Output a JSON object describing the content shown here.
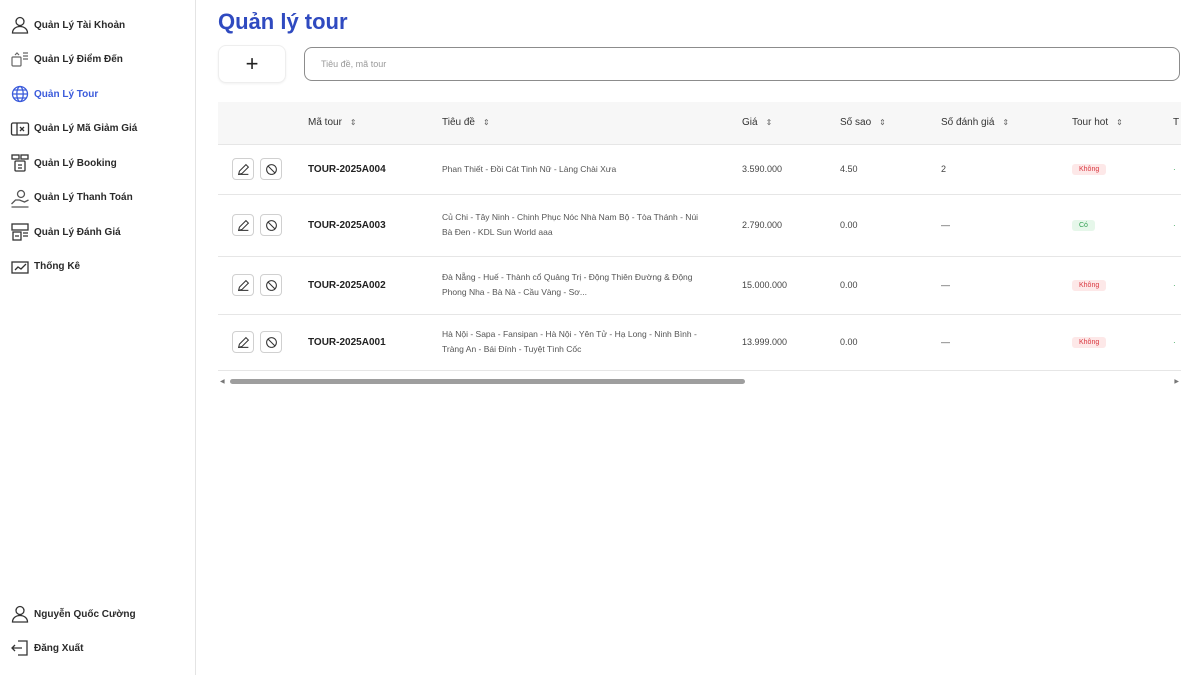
{
  "sidebar": {
    "items": [
      {
        "label": "Quản Lý Tài Khoản",
        "icon": "user-icon"
      },
      {
        "label": "Quản Lý Điểm Đến",
        "icon": "location-icon"
      },
      {
        "label": "Quản Lý Tour",
        "icon": "globe-icon",
        "active": true
      },
      {
        "label": "Quản Lý Mã Giảm Giá",
        "icon": "ticket-icon"
      },
      {
        "label": "Quản Lý Booking",
        "icon": "booking-icon"
      },
      {
        "label": "Quản Lý Thanh Toán",
        "icon": "payment-icon"
      },
      {
        "label": "Quản Lý Đánh Giá",
        "icon": "review-icon"
      },
      {
        "label": "Thống Kê",
        "icon": "chart-icon"
      }
    ],
    "user_name": "Nguyễn Quốc Cường",
    "logout_label": "Đăng Xuất"
  },
  "main": {
    "title": "Quản lý tour",
    "add_button": "+",
    "search_placeholder": "Tiêu đề, mã tour"
  },
  "table": {
    "headers": [
      "Mã tour",
      "Tiêu đề",
      "Giá",
      "Số sao",
      "Số đánh giá",
      "Tour hot",
      "T"
    ],
    "rows": [
      {
        "code": "TOUR-2025A004",
        "title": "Phan Thiết - Đồi Cát Tinh Nữ - Làng Chài Xưa",
        "price": "3.590.000",
        "stars": "4.50",
        "reviews": "2",
        "hot": "Không",
        "hot_type": "no"
      },
      {
        "code": "TOUR-2025A003",
        "title": "Củ Chi - Tây Ninh - Chinh Phục Nóc Nhà Nam Bộ - Tòa Thánh - Núi Bà Đen - KDL Sun World aaa",
        "price": "2.790.000",
        "stars": "0.00",
        "reviews": "—",
        "hot": "Có",
        "hot_type": "yes"
      },
      {
        "code": "TOUR-2025A002",
        "title": "Đà Nẵng - Huế - Thành cổ Quảng Trị - Động Thiên Đường & Động Phong Nha - Bà Nà - Cầu Vàng - Sơ...",
        "price": "15.000.000",
        "stars": "0.00",
        "reviews": "—",
        "hot": "Không",
        "hot_type": "no"
      },
      {
        "code": "TOUR-2025A001",
        "title": "Hà Nội - Sapa - Fansipan - Hà Nội - Yên Tử - Hạ Long - Ninh Bình - Tràng An - Bái Đính - Tuyệt Tình Cốc",
        "price": "13.999.000",
        "stars": "0.00",
        "reviews": "—",
        "hot": "Không",
        "hot_type": "no"
      }
    ]
  },
  "colors": {
    "accent": "#2f4ac0",
    "active_nav": "#3b5bdb",
    "badge_no": "#d9363e",
    "badge_yes": "#2e9e4f"
  }
}
